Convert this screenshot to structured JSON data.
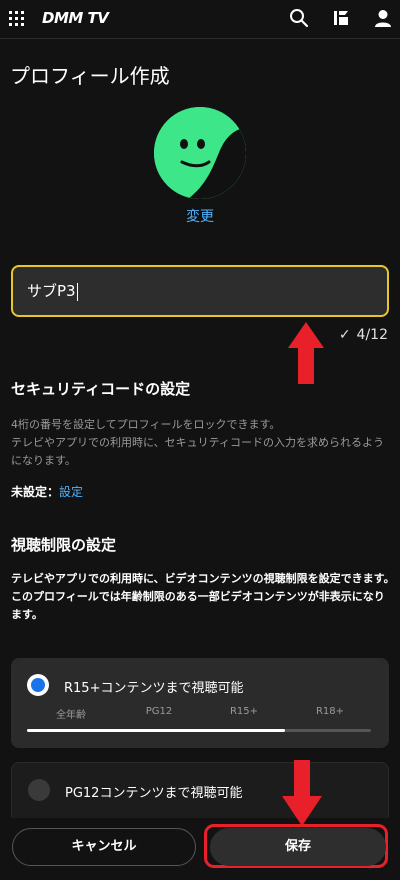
{
  "header": {
    "logo": "DMM TV",
    "icons": [
      "grid-menu-icon",
      "search-icon",
      "clapperboard-icon",
      "user-icon"
    ]
  },
  "page_title": "プロフィール作成",
  "avatar": {
    "change_label": "変更",
    "color": "#3ee68a"
  },
  "name_input": {
    "value": "サブP3",
    "counter": "4/12",
    "border_color": "#e6c829"
  },
  "security": {
    "title": "セキュリティコードの設定",
    "description": "4桁の番号を設定してプロフィールをロックできます。\nテレビやアプリでの利用時に、セキュリティコードの入力を求められるようになります。",
    "status_label": "未設定：",
    "status_link": "設定"
  },
  "viewing": {
    "title": "視聴制限の設定",
    "description": "テレビやアプリでの利用時に、ビデオコンテンツの視聴制限を設定できます。\nこのプロフィールでは年齢制限のある一部ビデオコンテンツが非表示になります。",
    "options": [
      {
        "label": "R15+コンテンツまで視聴可能",
        "selected": true,
        "level": 0.75,
        "ticks": [
          "全年齢",
          "PG12",
          "R15+",
          "R18+"
        ]
      },
      {
        "label": "PG12コンテンツまで視聴可能",
        "selected": false
      }
    ]
  },
  "footer": {
    "cancel_label": "キャンセル",
    "save_label": "保存"
  },
  "colors": {
    "accent": "#1a73e8",
    "link": "#4fb3ff",
    "annotation_red": "#e8202a"
  }
}
